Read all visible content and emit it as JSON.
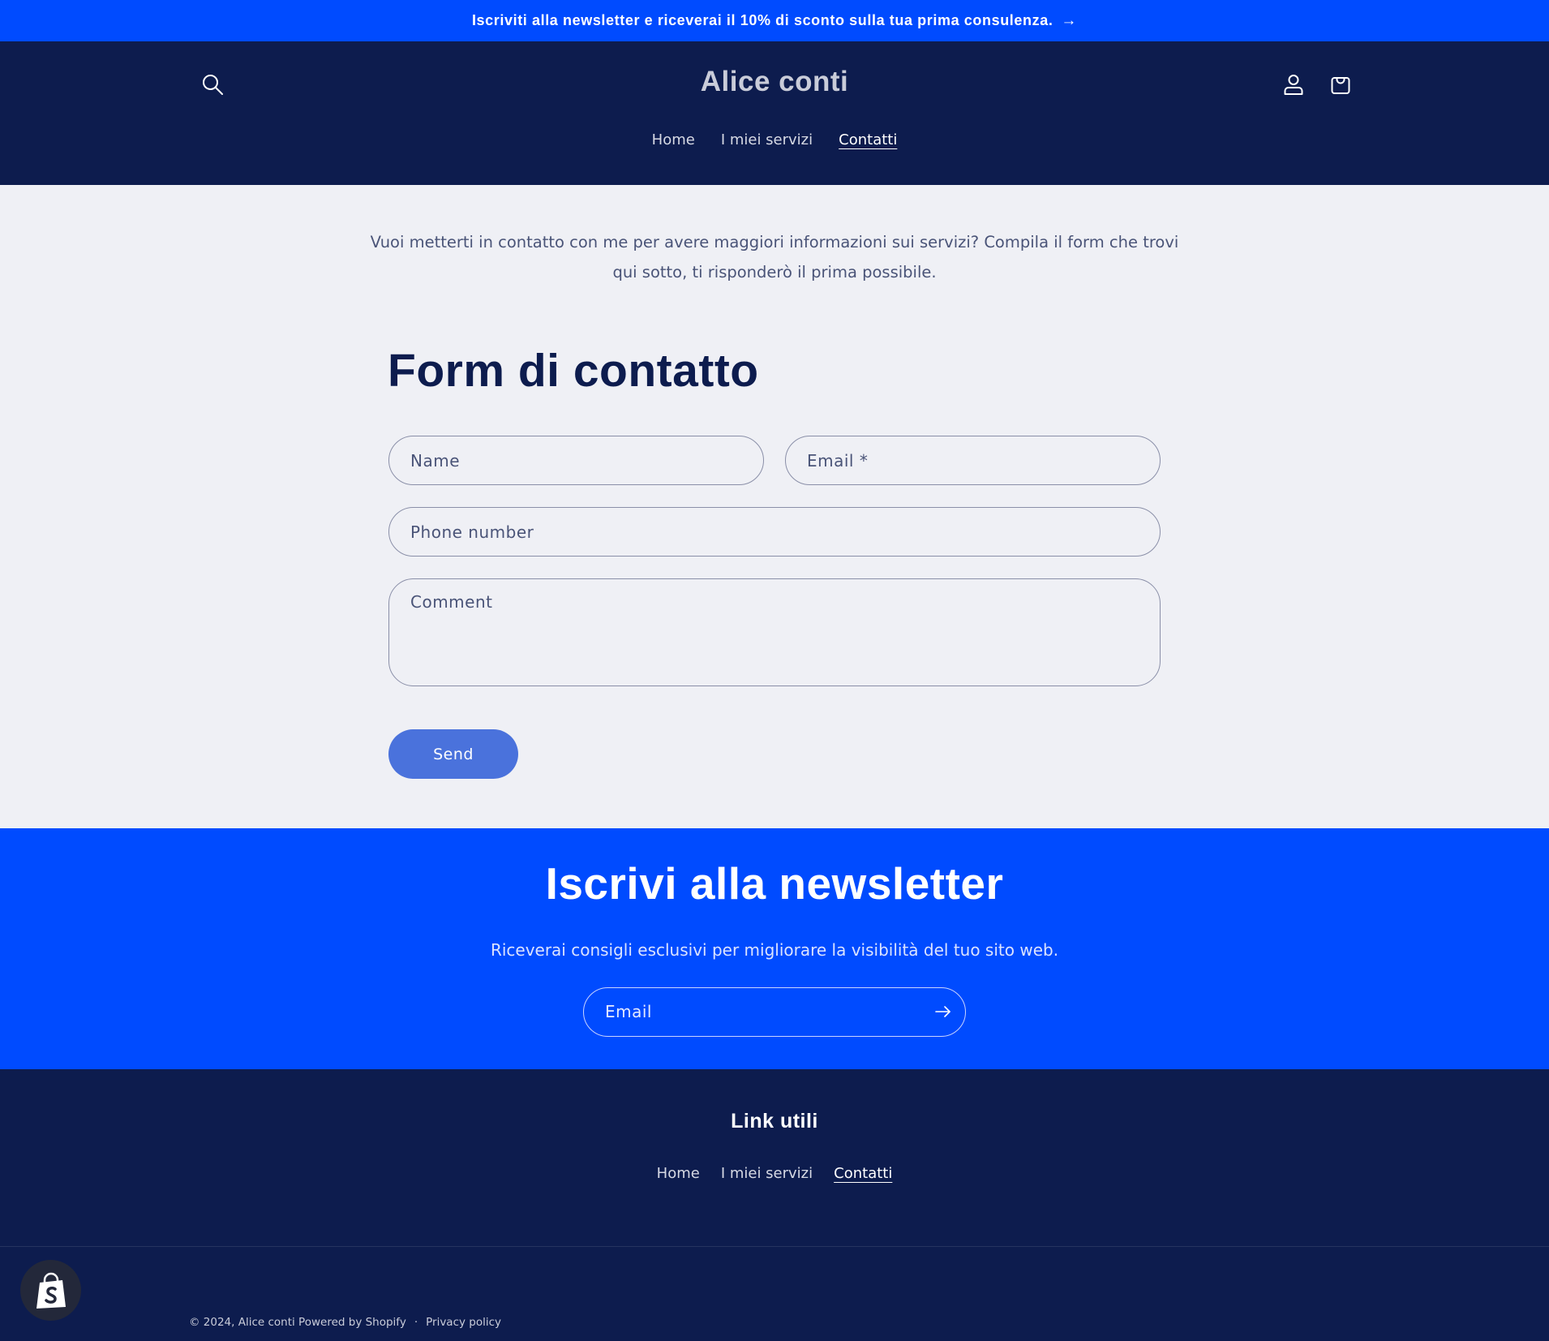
{
  "announcement": {
    "text": "Iscriviti alla newsletter e riceverai il 10% di sconto sulla tua prima consulenza.",
    "arrow": "→"
  },
  "header": {
    "logo": "Alice conti",
    "icons": [
      "search-icon",
      "account-icon",
      "cart-icon"
    ],
    "nav": [
      {
        "label": "Home",
        "active": false
      },
      {
        "label": "I miei servizi",
        "active": false
      },
      {
        "label": "Contatti",
        "active": true
      }
    ]
  },
  "intro": {
    "line1": "Vuoi metterti in contatto con me per avere maggiori informazioni sui servizi? Compila il form che trovi",
    "line2": "qui sotto, ti risponderò il prima possibile."
  },
  "contact_form": {
    "title": "Form di contatto",
    "name_placeholder": "Name",
    "email_placeholder": "Email *",
    "phone_placeholder": "Phone number",
    "comment_placeholder": "Comment",
    "send_label": "Send"
  },
  "newsletter": {
    "title": "Iscrivi alla newsletter",
    "subtitle": "Riceverai consigli esclusivi per migliorare la visibilità del tuo sito web.",
    "email_placeholder": "Email",
    "submit_icon": "arrow-right-icon"
  },
  "footer": {
    "heading": "Link utili",
    "nav": [
      {
        "label": "Home",
        "active": false
      },
      {
        "label": "I miei servizi",
        "active": false
      },
      {
        "label": "Contatti",
        "active": true
      }
    ],
    "copyright": "© 2024, Alice conti Powered by Shopify",
    "separator": "·",
    "privacy": "Privacy policy"
  },
  "colors": {
    "announcement_bg": "#004bff",
    "header_bg": "#0d1c4e",
    "page_bg": "#eff0f5",
    "button_bg": "#4a72dc",
    "newsletter_bg": "#004bff"
  }
}
